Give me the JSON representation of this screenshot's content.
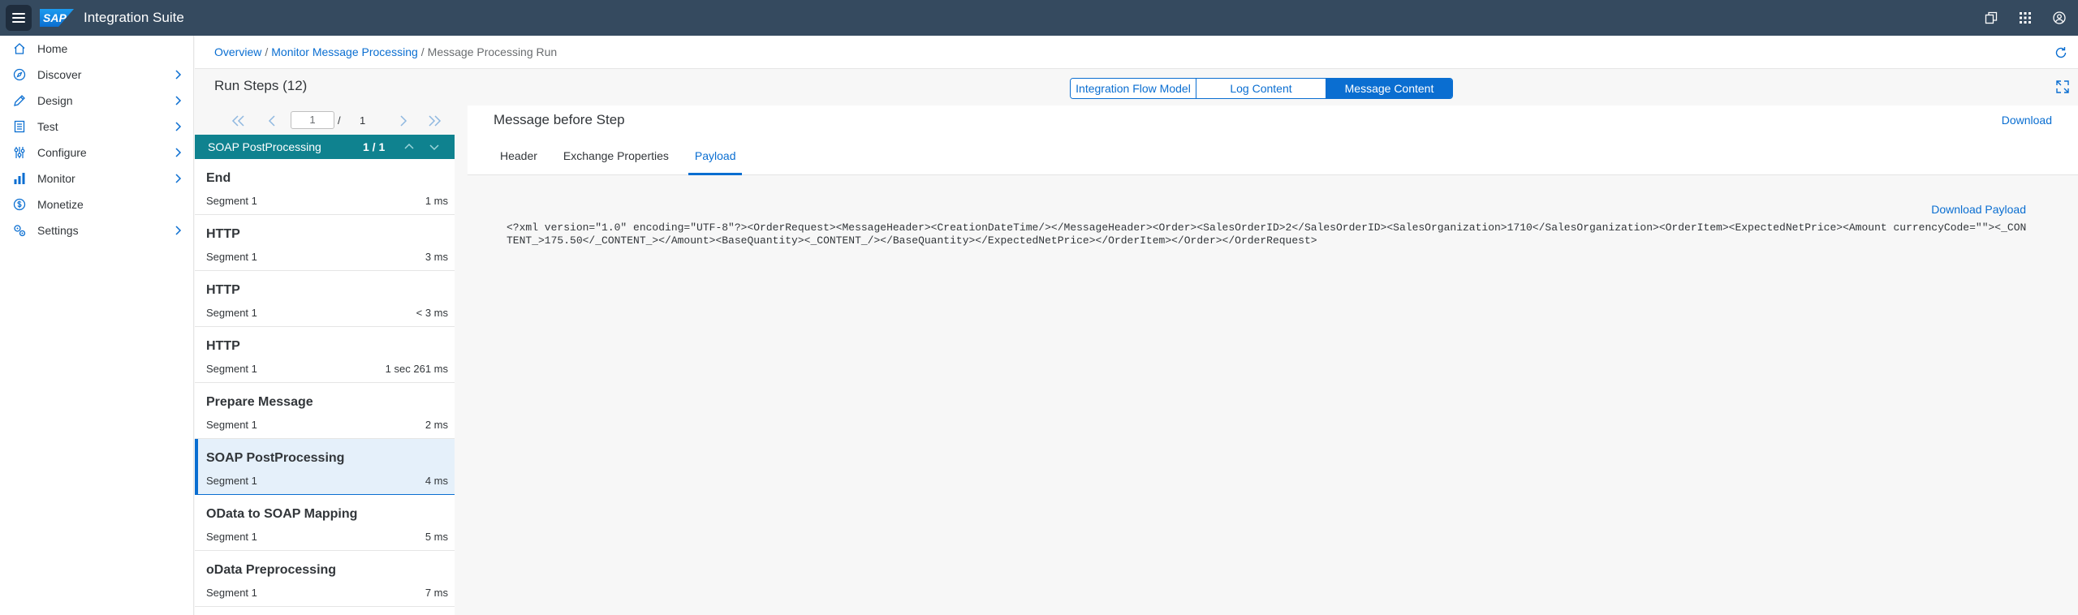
{
  "shell": {
    "logo_text": "SAP",
    "app_title": "Integration Suite"
  },
  "sidebar": {
    "items": [
      {
        "label": "Home",
        "icon": "home-icon",
        "has_children": false
      },
      {
        "label": "Discover",
        "icon": "compass-icon",
        "has_children": true
      },
      {
        "label": "Design",
        "icon": "pencil-icon",
        "has_children": true
      },
      {
        "label": "Test",
        "icon": "checklist-icon",
        "has_children": true
      },
      {
        "label": "Configure",
        "icon": "sliders-icon",
        "has_children": true
      },
      {
        "label": "Monitor",
        "icon": "bar-chart-icon",
        "has_children": true
      },
      {
        "label": "Monetize",
        "icon": "dollar-icon",
        "has_children": false
      },
      {
        "label": "Settings",
        "icon": "gears-icon",
        "has_children": true
      }
    ]
  },
  "breadcrumb": {
    "items": [
      "Overview",
      "Monitor Message Processing"
    ],
    "separator": "/",
    "current": "Message Processing Run"
  },
  "run_steps": {
    "title": "Run Steps (12)",
    "page_current": "1",
    "page_slash": "/",
    "page_total": "1",
    "selected_name": "SOAP PostProcessing",
    "selected_count": "1 / 1",
    "steps": [
      {
        "name": "End",
        "segment": "Segment 1",
        "duration": "1 ms"
      },
      {
        "name": "HTTP",
        "segment": "Segment 1",
        "duration": "3 ms"
      },
      {
        "name": "HTTP",
        "segment": "Segment 1",
        "duration": "< 3 ms"
      },
      {
        "name": "HTTP",
        "segment": "Segment 1",
        "duration": "1 sec 261 ms"
      },
      {
        "name": "Prepare Message",
        "segment": "Segment 1",
        "duration": "2 ms"
      },
      {
        "name": "SOAP PostProcessing",
        "segment": "Segment 1",
        "duration": "4 ms"
      },
      {
        "name": "OData to SOAP Mapping",
        "segment": "Segment 1",
        "duration": "5 ms"
      },
      {
        "name": "oData Preprocessing",
        "segment": "Segment 1",
        "duration": "7 ms"
      }
    ]
  },
  "view_switch": {
    "options": [
      "Integration Flow Model",
      "Log Content",
      "Message Content"
    ],
    "selected": "Message Content"
  },
  "message": {
    "title": "Message before Step",
    "download_label": "Download",
    "tabs": [
      "Header",
      "Exchange Properties",
      "Payload"
    ],
    "active_tab": "Payload",
    "download_payload_label": "Download Payload",
    "payload": "<?xml version=\"1.0\" encoding=\"UTF-8\"?><OrderRequest><MessageHeader><CreationDateTime/></MessageHeader><Order><SalesOrderID>2</SalesOrderID><SalesOrganization>1710</SalesOrganization><OrderItem><ExpectedNetPrice><Amount currencyCode=\"\"><_CONTENT_>175.50</_CONTENT_></Amount><BaseQuantity><_CONTENT_/></BaseQuantity></ExpectedNetPrice></OrderItem></Order></OrderRequest>"
  },
  "colors": {
    "shell_bg": "#354a5f",
    "accent": "#0a6ed1",
    "selected_step_bar": "#0f828f"
  }
}
